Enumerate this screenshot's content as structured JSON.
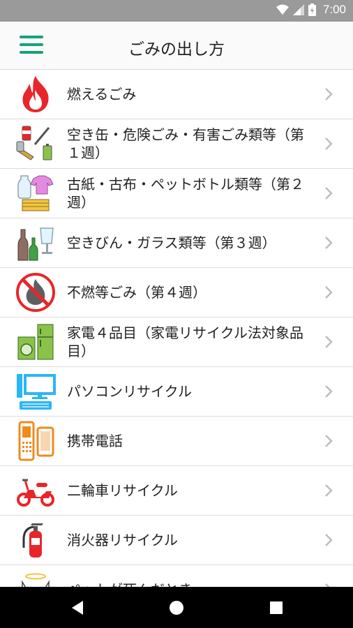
{
  "status_bar": {
    "time": "7:00"
  },
  "header": {
    "title": "ごみの出し方"
  },
  "list": {
    "items": [
      {
        "label": "燃えるごみ",
        "icon": "fire-icon"
      },
      {
        "label": "空き缶・危険ごみ・有害ごみ類等（第１週）",
        "icon": "cans-hazardous-icon"
      },
      {
        "label": "古紙・古布・ペットボトル類等（第２週）",
        "icon": "paper-cloth-bottles-icon"
      },
      {
        "label": "空きびん・ガラス類等（第３週）",
        "icon": "bottles-glass-icon"
      },
      {
        "label": "不燃等ごみ（第４週）",
        "icon": "no-burn-icon"
      },
      {
        "label": "家電４品目（家電リサイクル法対象品目）",
        "icon": "appliances-icon"
      },
      {
        "label": "パソコンリサイクル",
        "icon": "computer-icon"
      },
      {
        "label": "携帯電話",
        "icon": "mobile-phone-icon"
      },
      {
        "label": "二輪車リサイクル",
        "icon": "scooter-icon"
      },
      {
        "label": "消火器リサイクル",
        "icon": "fire-extinguisher-icon"
      },
      {
        "label": "ペットが死んだとき",
        "icon": "pet-angel-icon"
      }
    ]
  },
  "colors": {
    "accent": "#18a07a",
    "fire": "#e8262a",
    "chevron": "#bdbdbd"
  }
}
